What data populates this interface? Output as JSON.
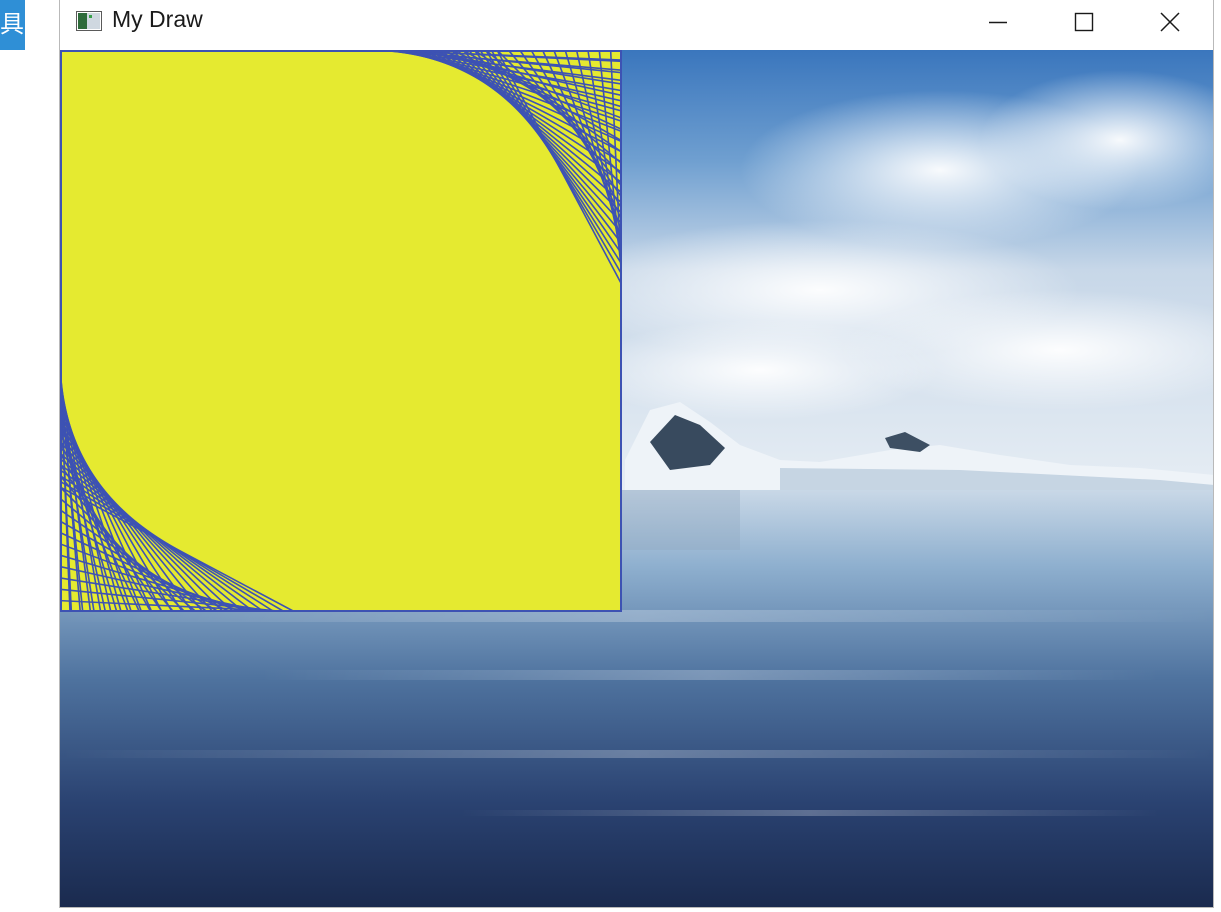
{
  "side_tab": {
    "text": "具"
  },
  "window": {
    "title": "My Draw",
    "icon": "app-window-icon",
    "controls": {
      "minimize": "minimize-icon",
      "maximize": "maximize-icon",
      "close": "close-icon"
    }
  },
  "canvas": {
    "background": "ocean-iceberg-photo",
    "shape": {
      "description_icon": "quarter-curve-string-art",
      "fill_color": "#e5ea30",
      "stroke_color": "#3d52b3"
    }
  },
  "colors": {
    "chip": "#2f8fd6",
    "sky": "#3f7ec2",
    "water_dark": "#1c2f57"
  }
}
